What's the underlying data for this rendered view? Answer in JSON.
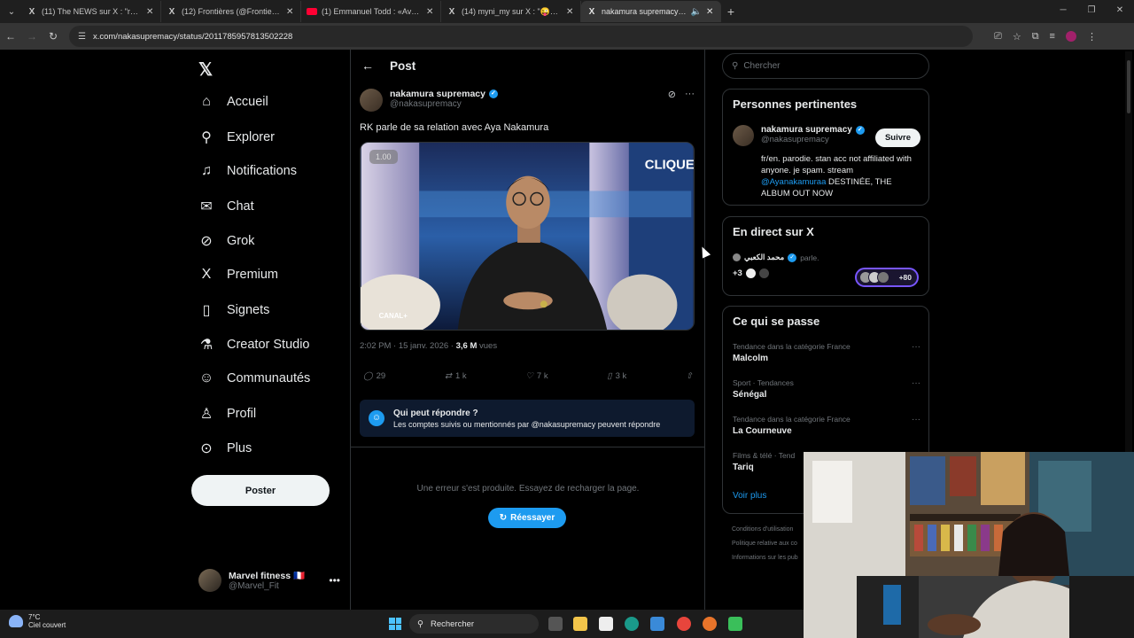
{
  "browser": {
    "tabs": [
      {
        "icon": "X",
        "title": "(11) The NEWS sur X : \"ra😭 Na"
      },
      {
        "icon": "X",
        "title": "(12) Frontières (@Frontieresme"
      },
      {
        "icon": "yt",
        "title": "(1) Emmanuel Todd : «Avec le C"
      },
      {
        "icon": "X",
        "title": "(14) myni_my sur X : \"😜😂😡 I"
      },
      {
        "icon": "X",
        "title": "nakamura supremacy sur X"
      }
    ],
    "url": "x.com/nakasupremacy/status/2011785957813502228"
  },
  "nav": {
    "items": [
      {
        "icon": "home-icon",
        "glyph": "⌂",
        "label": "Accueil"
      },
      {
        "icon": "search-icon",
        "glyph": "⚲",
        "label": "Explorer"
      },
      {
        "icon": "bell-icon",
        "glyph": "☀",
        "label": "Notifications"
      },
      {
        "icon": "mail-icon",
        "glyph": "✉",
        "label": "Chat"
      },
      {
        "icon": "grok-icon",
        "glyph": "⊘",
        "label": "Grok"
      },
      {
        "icon": "x-premium-icon",
        "glyph": "𝕏",
        "label": "Premium"
      },
      {
        "icon": "bookmark-icon",
        "glyph": "☐",
        "label": "Signets"
      },
      {
        "icon": "flask-icon",
        "glyph": "⚗",
        "label": "Creator Studio"
      },
      {
        "icon": "people-icon",
        "glyph": "☺",
        "label": "Communautés"
      },
      {
        "icon": "person-icon",
        "glyph": "☻",
        "label": "Profil"
      },
      {
        "icon": "more-circle-icon",
        "glyph": "⊙",
        "label": "Plus"
      }
    ],
    "post_button": "Poster",
    "account": {
      "name": "Marvel fitness 🇫🇷",
      "handle": "@Marvel_Fit"
    }
  },
  "post": {
    "header_title": "Post",
    "author_name": "nakamura supremacy",
    "author_handle": "@nakasupremacy",
    "text": "RK parle de sa relation avec Aya Nakamura",
    "video_speed": "1.00",
    "video_logo": "CLIQUE",
    "video_channel": "CANAL+",
    "time": "2:02 PM · 15 janv. 2026 · ",
    "views_count": "3,6 M",
    "views_label": " vues",
    "replies": "29",
    "reposts": "1 k",
    "likes": "7 k",
    "bookmarks": "3 k",
    "reply_title": "Qui peut répondre ?",
    "reply_desc": "Les comptes suivis ou mentionnés par @nakasupremacy peuvent répondre",
    "error_text": "Une erreur s'est produite. Essayez de recharger la page.",
    "retry_label": "Réessayer"
  },
  "sidebar": {
    "search_placeholder": "Chercher",
    "relevant": {
      "title": "Personnes pertinentes",
      "name": "nakamura supremacy",
      "handle": "@nakasupremacy",
      "follow": "Suivre",
      "bio_part1": "fr/en. parodie. stan acc not affiliated with anyone. je spam. stream ",
      "bio_mention": "@Ayanakamuraa",
      "bio_part2": " DESTINÉE, THE ALBUM OUT NOW"
    },
    "live": {
      "title": "En direct sur X",
      "host": "محمد الكعبي",
      "host_suffix": "parle.",
      "plus_count": "+3",
      "listeners": "+80"
    },
    "trends": {
      "title": "Ce qui se passe",
      "items": [
        {
          "category": "Tendance dans la catégorie France",
          "name": "Malcolm"
        },
        {
          "category": "Sport · Tendances",
          "name": "Sénégal"
        },
        {
          "category": "Tendance dans la catégorie France",
          "name": "La Courneuve"
        },
        {
          "category": "Films & télé · Tend",
          "name": "Tariq"
        }
      ],
      "see_more": "Voir plus"
    },
    "footer": [
      "Conditions d'utilisation",
      "Politique relative aux co",
      "Informations sur les pub"
    ]
  },
  "taskbar": {
    "temp": "7°C",
    "weather": "Ciel couvert",
    "search": "Rechercher"
  },
  "colors": {
    "accent": "#1d9bf0",
    "bg": "#000000",
    "muted": "#71767b"
  }
}
